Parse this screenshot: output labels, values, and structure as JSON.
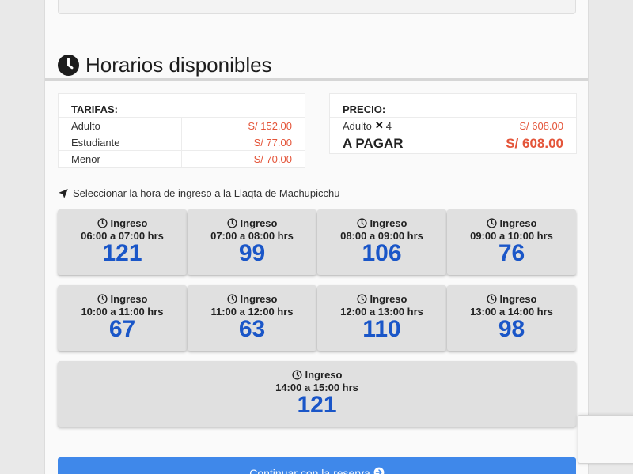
{
  "section": {
    "title": "Horarios disponibles"
  },
  "tarifas": {
    "header": "TARIFAS:",
    "rows": [
      {
        "label": "Adulto",
        "price": "S/ 152.00"
      },
      {
        "label": "Estudiante",
        "price": "S/ 77.00"
      },
      {
        "label": "Menor",
        "price": "S/ 70.00"
      }
    ]
  },
  "precio": {
    "header": "PRECIO:",
    "item_label": "Adulto",
    "item_times": "✕",
    "item_qty": "4",
    "item_price": "S/ 608.00",
    "total_label": "A PAGAR",
    "total_price": "S/ 608.00"
  },
  "instruction": "Seleccionar la hora de ingreso a la Llaqta de Machupicchu",
  "slots": [
    {
      "label": "Ingreso",
      "time": "06:00 a 07:00 hrs",
      "available": "121"
    },
    {
      "label": "Ingreso",
      "time": "07:00 a 08:00 hrs",
      "available": "99"
    },
    {
      "label": "Ingreso",
      "time": "08:00 a 09:00 hrs",
      "available": "106"
    },
    {
      "label": "Ingreso",
      "time": "09:00 a 10:00 hrs",
      "available": "76"
    },
    {
      "label": "Ingreso",
      "time": "10:00 a 11:00 hrs",
      "available": "67"
    },
    {
      "label": "Ingreso",
      "time": "11:00 a 12:00 hrs",
      "available": "63"
    },
    {
      "label": "Ingreso",
      "time": "12:00 a 13:00 hrs",
      "available": "110"
    },
    {
      "label": "Ingreso",
      "time": "13:00 a 14:00 hrs",
      "available": "98"
    },
    {
      "label": "Ingreso",
      "time": "14:00 a 15:00 hrs",
      "available": "121"
    }
  ],
  "continue_button": {
    "label": "Continuar con la reserva"
  },
  "colors": {
    "accent": "#3f88ea",
    "price": "#e4553a",
    "count": "#1a56c8"
  }
}
